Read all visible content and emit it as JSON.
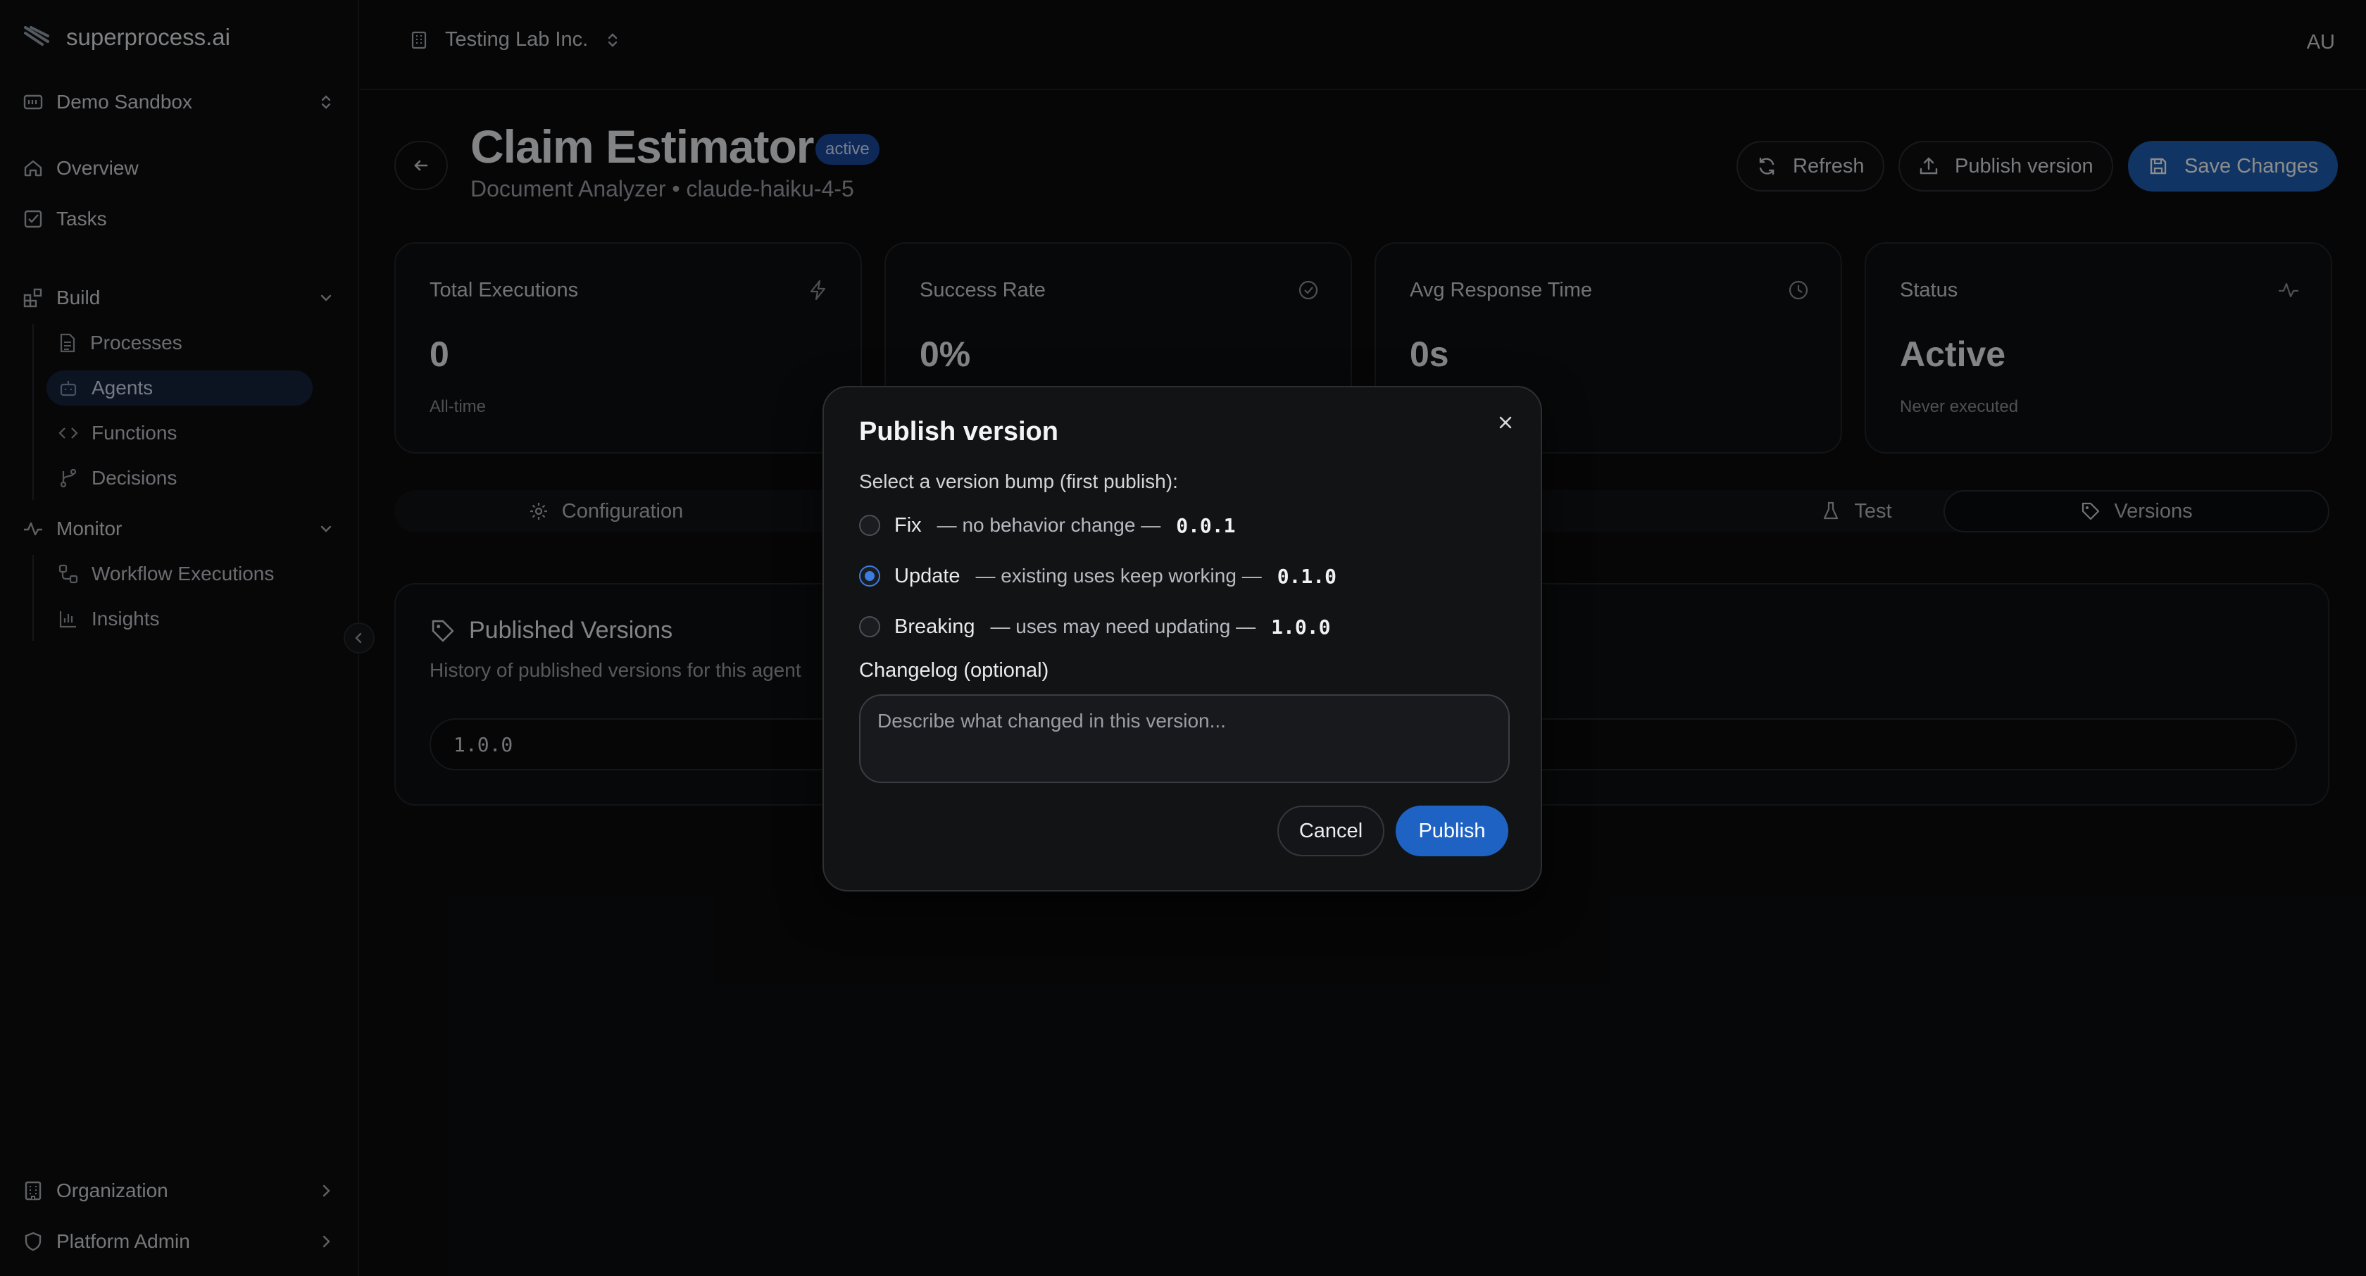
{
  "sidebar": {
    "logo_text": "superprocess.ai",
    "workspace": "Demo Sandbox",
    "nav": {
      "overview": "Overview",
      "tasks": "Tasks",
      "build": "Build",
      "processes": "Processes",
      "agents": "Agents",
      "functions": "Functions",
      "decisions": "Decisions",
      "monitor": "Monitor",
      "workflow_executions": "Workflow Executions",
      "insights": "Insights",
      "organization": "Organization",
      "platform_admin": "Platform Admin"
    }
  },
  "topbar": {
    "org_name": "Testing Lab Inc.",
    "user_initials": "AU"
  },
  "page": {
    "title": "Claim Estimator",
    "status_badge": "active",
    "subtitle": "Document Analyzer • claude-haiku-4-5",
    "actions": {
      "refresh": "Refresh",
      "publish_version": "Publish version",
      "save_changes": "Save Changes"
    }
  },
  "stats": {
    "total_executions": {
      "label": "Total Executions",
      "value": "0",
      "note": "All-time"
    },
    "success_rate": {
      "label": "Success Rate",
      "value": "0%"
    },
    "avg_response": {
      "label": "Avg Response Time",
      "value": "0s"
    },
    "status": {
      "label": "Status",
      "value": "Active",
      "note": "Never executed"
    }
  },
  "tabs": {
    "configuration": "Configuration",
    "test": "Test",
    "versions": "Versions"
  },
  "versions_panel": {
    "title": "Published Versions",
    "description": "History of published versions for this agent",
    "rows": [
      "1.0.0"
    ]
  },
  "modal": {
    "title": "Publish version",
    "instruction": "Select a version bump (first publish):",
    "options": [
      {
        "label": "Fix",
        "description": "— no behavior change —",
        "version": "0.0.1",
        "selected": false
      },
      {
        "label": "Update",
        "description": "— existing uses keep working —",
        "version": "0.1.0",
        "selected": true
      },
      {
        "label": "Breaking",
        "description": "— uses may need updating —",
        "version": "1.0.0",
        "selected": false
      }
    ],
    "changelog_label": "Changelog (optional)",
    "changelog_placeholder": "Describe what changed in this version...",
    "cancel": "Cancel",
    "publish": "Publish"
  },
  "colors": {
    "accent": "#1e63c4",
    "background": "#0b0c0e",
    "badge": "#1b4ba0"
  }
}
